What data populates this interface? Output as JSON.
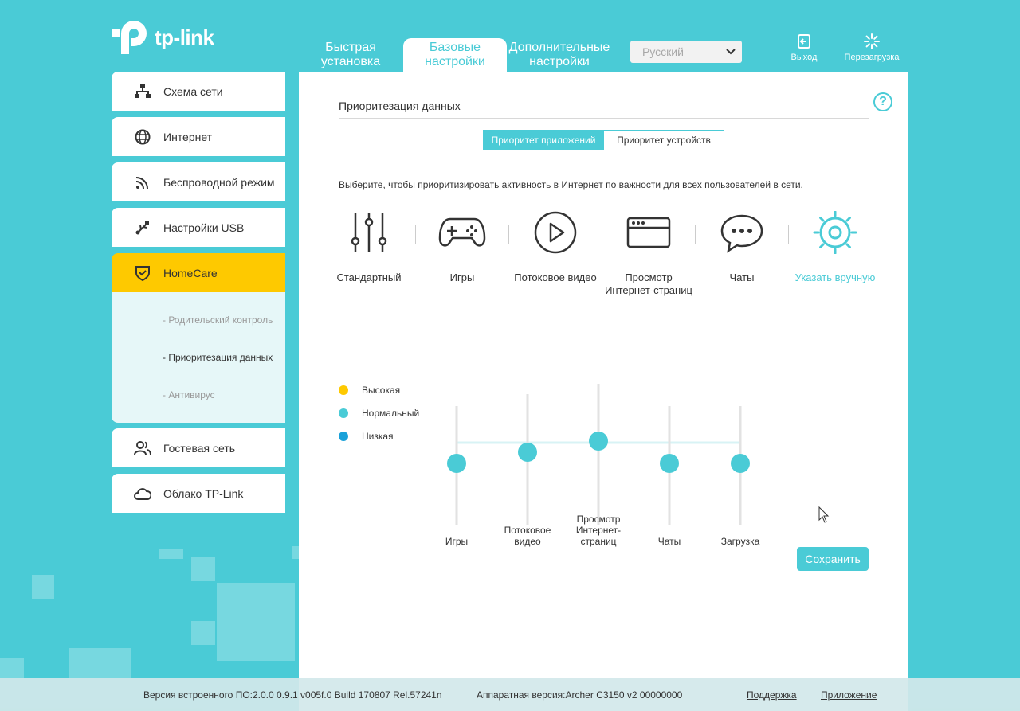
{
  "brand": {
    "name": "tp-link"
  },
  "top_nav": {
    "tabs": [
      {
        "label": "Быстрая установка"
      },
      {
        "label": "Базовые настройки"
      },
      {
        "label": "Дополнительные настройки"
      }
    ],
    "language": {
      "selected": "Русский"
    },
    "logout_label": "Выход",
    "reboot_label": "Перезагрузка"
  },
  "sidebar": {
    "items": [
      {
        "label": "Схема сети",
        "icon": "network-map-icon"
      },
      {
        "label": "Интернет",
        "icon": "globe-icon"
      },
      {
        "label": "Беспроводной режим",
        "icon": "wireless-icon"
      },
      {
        "label": "Настройки USB",
        "icon": "usb-icon"
      },
      {
        "label": "HomeCare",
        "icon": "shield-icon"
      },
      {
        "label": "Гостевая сеть",
        "icon": "guest-users-icon"
      },
      {
        "label": "Облако TP-Link",
        "icon": "cloud-icon"
      }
    ],
    "sub_items": [
      {
        "label": "- Родительский контроль"
      },
      {
        "label": "- Приоритезация данных"
      },
      {
        "label": "- Антивирус"
      }
    ]
  },
  "main": {
    "title": "Приоритезация данных",
    "segments": {
      "app": "Приоритет приложений",
      "device": "Приоритет устройств"
    },
    "description": "Выберите, чтобы приоритизировать активность в Интернет по важности для всех пользователей в сети.",
    "modes": [
      {
        "label": "Стандартный",
        "icon": "sliders-icon"
      },
      {
        "label": "Игры",
        "icon": "gamepad-icon"
      },
      {
        "label": "Потоковое видео",
        "icon": "play-icon"
      },
      {
        "label": "Просмотр Интернет-страниц",
        "icon": "browser-icon"
      },
      {
        "label": "Чаты",
        "icon": "chat-icon"
      },
      {
        "label": "Указать вручную",
        "icon": "gear-icon"
      }
    ],
    "legend": [
      {
        "label": "Высокая",
        "color": "#fec900"
      },
      {
        "label": "Нормальный",
        "color": "#4acbd6"
      },
      {
        "label": "Низкая",
        "color": "#1aa1d9"
      }
    ],
    "sliders": [
      {
        "label": "Игры",
        "level": "normal"
      },
      {
        "label": "Потоковое видео",
        "level": "normal"
      },
      {
        "label": "Просмотр Интернет-страниц",
        "level": "normal"
      },
      {
        "label": "Чаты",
        "level": "normal"
      },
      {
        "label": "Загрузка",
        "level": "normal"
      }
    ],
    "save_label": "Сохранить"
  },
  "footer": {
    "firmware": "Версия встроенного ПО:2.0.0 0.9.1 v005f.0 Build 170807 Rel.57241n",
    "hardware": "Аппаратная версия:Archer C3150 v2 00000000",
    "support_label": "Поддержка",
    "app_label": "Приложение"
  },
  "colors": {
    "accent": "#4acbd6",
    "highlight": "#fec900",
    "low": "#1aa1d9"
  }
}
